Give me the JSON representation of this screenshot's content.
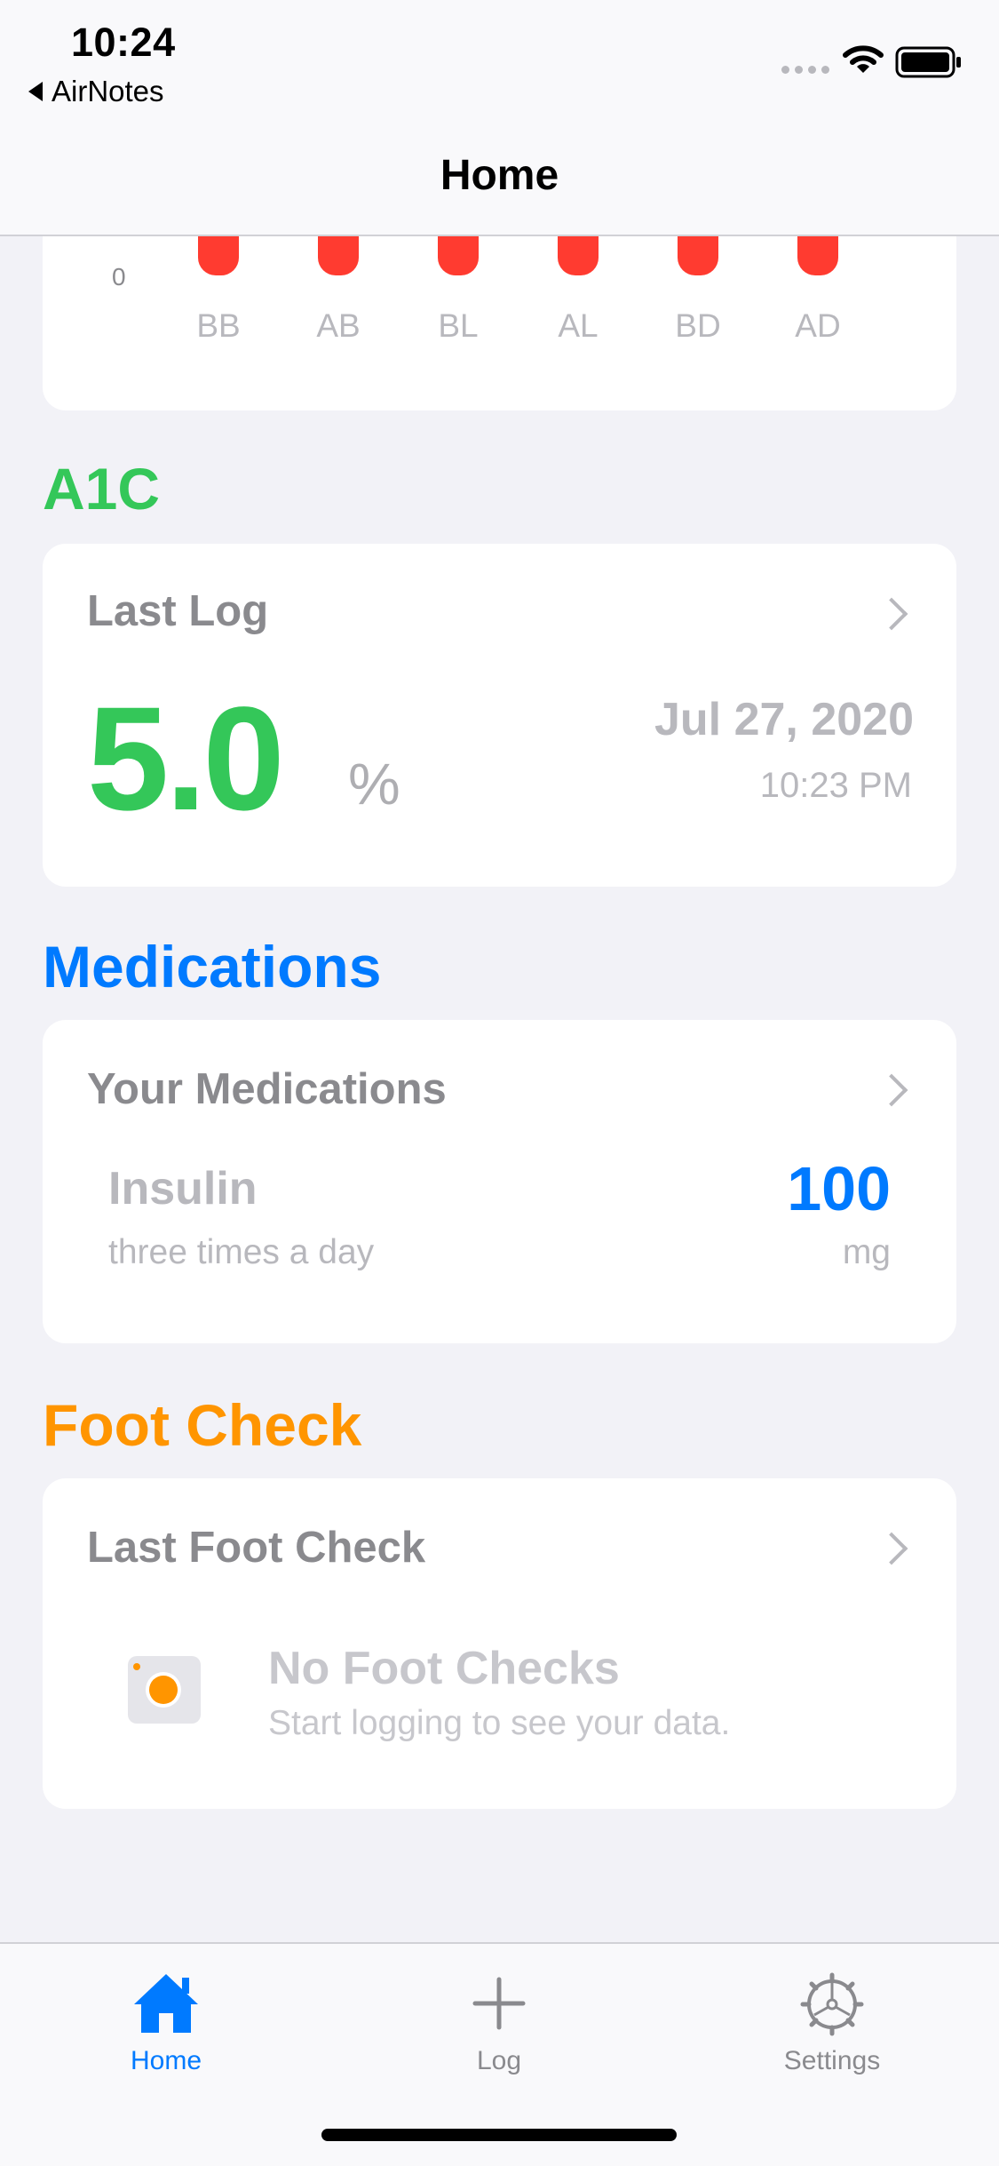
{
  "status_bar": {
    "time": "10:24",
    "back_app": "AirNotes"
  },
  "nav": {
    "title": "Home"
  },
  "glucose_chart": {
    "y_tick": "0",
    "bar_color": "#ff3b30"
  },
  "chart_data": {
    "type": "bar",
    "categories": [
      "BB",
      "AB",
      "BL",
      "AL",
      "BD",
      "AD"
    ],
    "yticks": [
      "0"
    ]
  },
  "a1c": {
    "section_title": "A1C",
    "card_heading": "Last Log",
    "value": "5.0",
    "unit": "%",
    "date": "Jul 27, 2020",
    "time": "10:23 PM",
    "accent": "#34c759"
  },
  "medications": {
    "section_title": "Medications",
    "card_heading": "Your Medications",
    "item_name": "Insulin",
    "item_frequency": "three times a day",
    "item_dose": "100",
    "item_unit": "mg",
    "accent": "#007aff"
  },
  "foot_check": {
    "section_title": "Foot Check",
    "card_heading": "Last Foot Check",
    "empty_title": "No Foot Checks",
    "empty_subtitle": "Start logging to see your data.",
    "accent": "#ff9500",
    "icon": "camera-icon"
  },
  "tab_bar": {
    "tabs": [
      {
        "label": "Home",
        "icon": "house-icon",
        "selected": true
      },
      {
        "label": "Log",
        "icon": "plus-icon",
        "selected": false
      },
      {
        "label": "Settings",
        "icon": "gear-icon",
        "selected": false
      }
    ],
    "selected_color": "#007aff",
    "unselected_color": "#8a8a8e"
  }
}
